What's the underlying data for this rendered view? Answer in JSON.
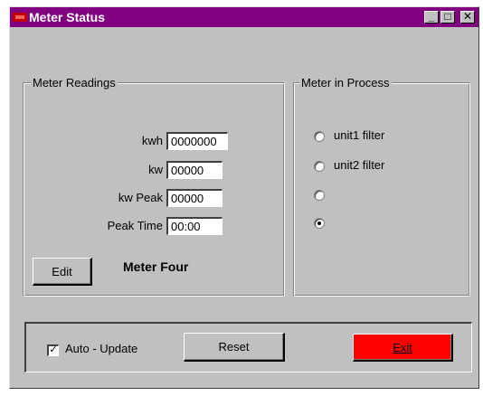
{
  "window": {
    "title": "Meter Status",
    "controls": {
      "minimize": "_",
      "maximize": "□",
      "close": "✕"
    }
  },
  "readings": {
    "group_label": "Meter Readings",
    "rows": [
      {
        "label": "kwh",
        "value": "0000000"
      },
      {
        "label": "kw",
        "value": "00000"
      },
      {
        "label": "kw Peak",
        "value": "00000"
      },
      {
        "label": "Peak Time",
        "value": "00:00"
      }
    ],
    "edit_label": "Edit",
    "meter_name": "Meter Four"
  },
  "process": {
    "group_label": "Meter in Process",
    "options": [
      {
        "label": "unit1 filter",
        "selected": false
      },
      {
        "label": "unit2 filter",
        "selected": false
      },
      {
        "label": "",
        "selected": false
      },
      {
        "label": "",
        "selected": true
      }
    ]
  },
  "footer": {
    "auto_update_label": "Auto - Update",
    "auto_update_checked": true,
    "reset_label": "Reset",
    "exit_label": "Exit",
    "exit_color": "#ff0000"
  },
  "colors": {
    "titlebar": "#800080",
    "face": "#c0c0c0"
  }
}
